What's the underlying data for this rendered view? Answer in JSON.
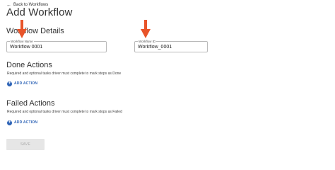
{
  "header": {
    "back_label": "Back to Workflows",
    "title": "Add Workflow"
  },
  "details": {
    "title": "Workflow Details",
    "name_field": {
      "label": "Workflow Name",
      "value": "Workflow 0001"
    },
    "id_field": {
      "label": "Workflow ID",
      "value": "Workflow_0001"
    }
  },
  "done": {
    "title": "Done Actions",
    "subtitle": "Required and optional tasks driver must complete to mark stops as Done",
    "add_label": "ADD ACTION"
  },
  "failed": {
    "title": "Failed Actions",
    "subtitle": "Required and optional tasks driver must complete to mark stops as Failed",
    "add_label": "ADD ACTION"
  },
  "footer": {
    "save_label": "SAVE"
  },
  "colors": {
    "accent": "#2d63b6",
    "annotation_arrow": "#e8542a"
  }
}
